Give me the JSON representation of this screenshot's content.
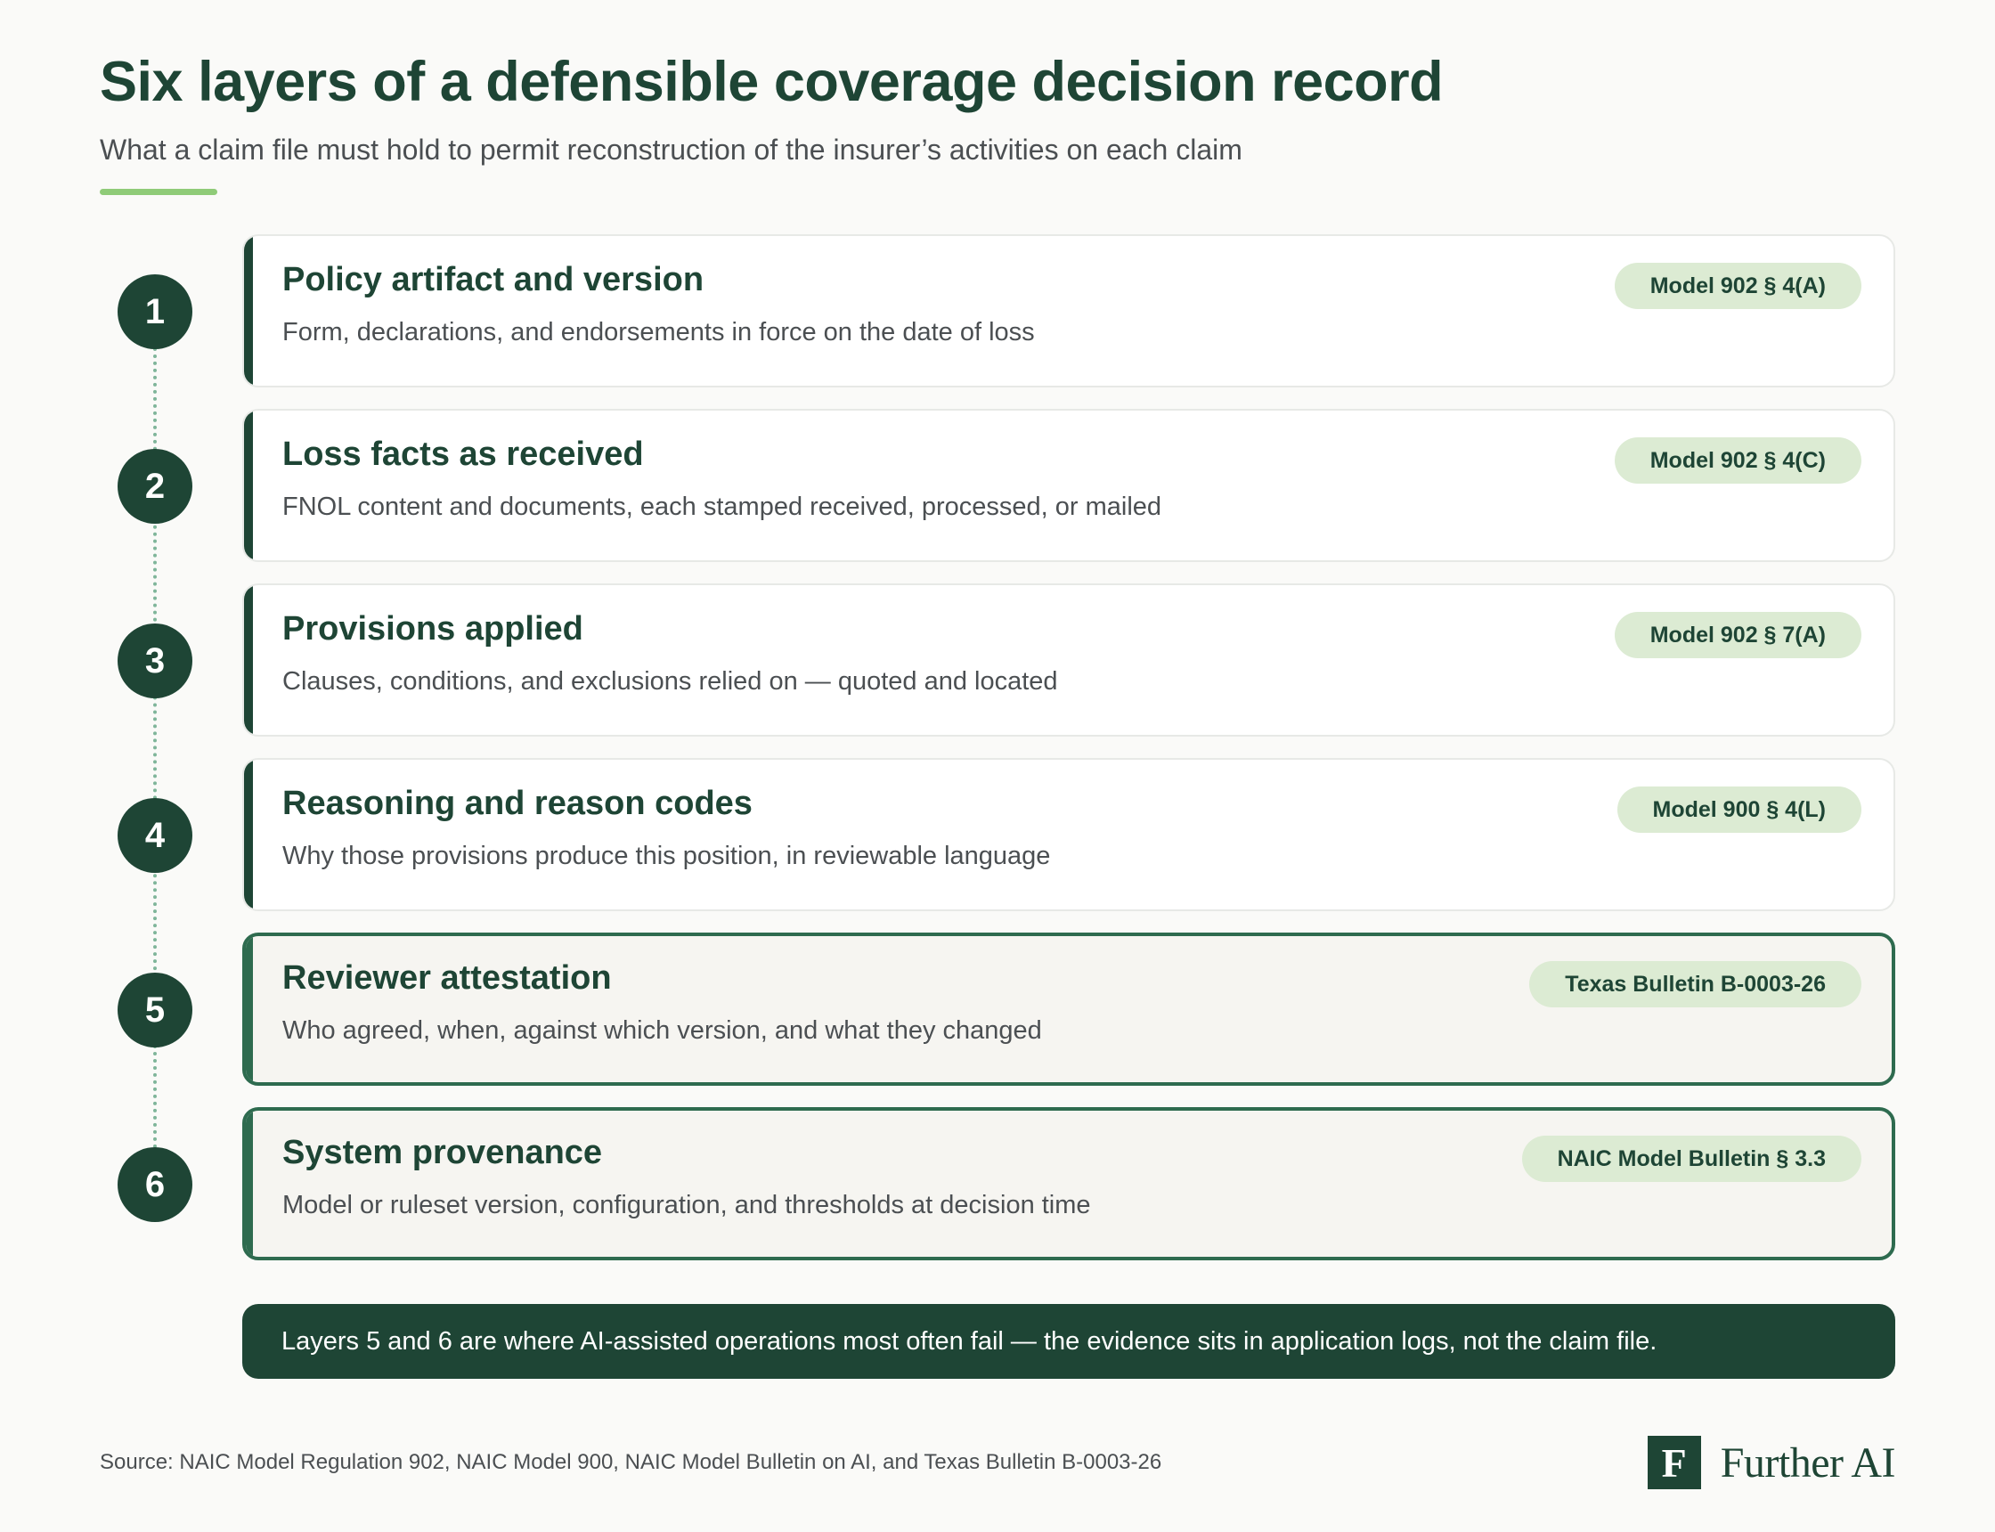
{
  "header": {
    "title": "Six layers of a defensible coverage decision record",
    "subtitle": "What a claim file must hold to permit reconstruction of the insurer’s activities on each claim"
  },
  "layers": [
    {
      "number": "1",
      "title": "Policy artifact and version",
      "description": "Form, declarations, and endorsements in force on the date of loss",
      "citation": "Model 902 § 4(A)",
      "highlighted": false
    },
    {
      "number": "2",
      "title": "Loss facts as received",
      "description": "FNOL content and documents, each stamped received, processed, or mailed",
      "citation": "Model 902 § 4(C)",
      "highlighted": false
    },
    {
      "number": "3",
      "title": "Provisions applied",
      "description": "Clauses, conditions, and exclusions relied on — quoted and located",
      "citation": "Model 902 § 7(A)",
      "highlighted": false
    },
    {
      "number": "4",
      "title": "Reasoning and reason codes",
      "description": "Why those provisions produce this position, in reviewable language",
      "citation": "Model 900 § 4(L)",
      "highlighted": false
    },
    {
      "number": "5",
      "title": "Reviewer attestation",
      "description": "Who agreed, when, against which version, and what they changed",
      "citation": "Texas Bulletin B-0003-26",
      "highlighted": true
    },
    {
      "number": "6",
      "title": "System provenance",
      "description": "Model or ruleset version, configuration, and thresholds at decision time",
      "citation": "NAIC Model Bulletin § 3.3",
      "highlighted": true
    }
  ],
  "callout": {
    "text": "Layers 5 and 6 are where AI-assisted operations most often fail — the evidence sits in application logs, not the claim file."
  },
  "footer": {
    "source": "Source: NAIC Model Regulation 902, NAIC Model 900, NAIC Model Bulletin on AI, and Texas Bulletin B-0003-26",
    "brand_mark": "F",
    "brand_name": "Further AI"
  },
  "colors": {
    "primary_dark_green": "#1E4535",
    "highlight_border_green": "#2E6B4F",
    "accent_green": "#8FCB78",
    "badge_background": "#DCEBD3"
  }
}
